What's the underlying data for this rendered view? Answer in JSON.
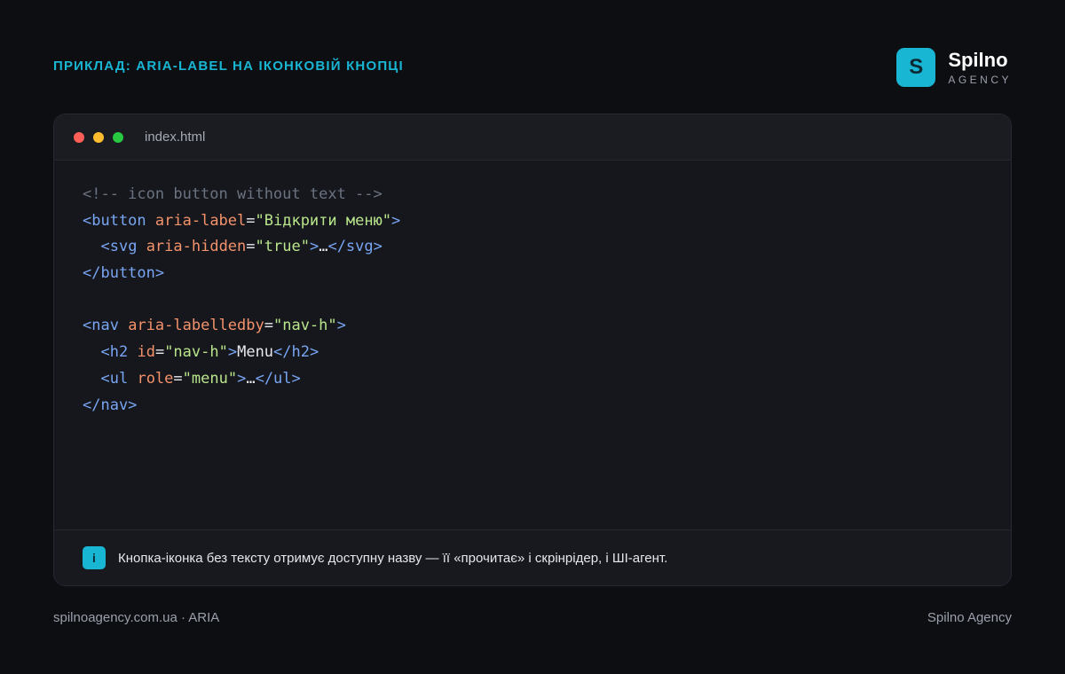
{
  "heading": "Приклад: aria-label на іконковій кнопці",
  "brand": {
    "mark": "S",
    "name": "Spilno",
    "subtitle": "AGENCY",
    "accent_color": "#19b6d4"
  },
  "window": {
    "filename": "index.html",
    "controls": [
      "close-dot",
      "minimize-dot",
      "maximize-dot"
    ]
  },
  "code": {
    "lines": [
      [
        {
          "t": "cm",
          "v": "<!-- icon button without text -->"
        }
      ],
      [
        {
          "t": "tg",
          "v": "<button"
        },
        {
          "t": "pl",
          "v": " "
        },
        {
          "t": "at",
          "v": "aria-label"
        },
        {
          "t": "pl",
          "v": "="
        },
        {
          "t": "st",
          "v": "\"Відкрити меню\""
        },
        {
          "t": "tg",
          "v": ">"
        }
      ],
      [
        {
          "t": "pl",
          "v": "  "
        },
        {
          "t": "tg",
          "v": "<svg"
        },
        {
          "t": "pl",
          "v": " "
        },
        {
          "t": "at",
          "v": "aria-hidden"
        },
        {
          "t": "pl",
          "v": "="
        },
        {
          "t": "st",
          "v": "\"true\""
        },
        {
          "t": "tg",
          "v": ">"
        },
        {
          "t": "pl",
          "v": "…"
        },
        {
          "t": "tg",
          "v": "</svg>"
        }
      ],
      [
        {
          "t": "tg",
          "v": "</button>"
        }
      ],
      [],
      [
        {
          "t": "tg",
          "v": "<nav"
        },
        {
          "t": "pl",
          "v": " "
        },
        {
          "t": "at",
          "v": "aria-labelledby"
        },
        {
          "t": "pl",
          "v": "="
        },
        {
          "t": "st",
          "v": "\"nav-h\""
        },
        {
          "t": "tg",
          "v": ">"
        }
      ],
      [
        {
          "t": "pl",
          "v": "  "
        },
        {
          "t": "tg",
          "v": "<h2"
        },
        {
          "t": "pl",
          "v": " "
        },
        {
          "t": "at",
          "v": "id"
        },
        {
          "t": "pl",
          "v": "="
        },
        {
          "t": "st",
          "v": "\"nav-h\""
        },
        {
          "t": "tg",
          "v": ">"
        },
        {
          "t": "pl",
          "v": "Menu"
        },
        {
          "t": "tg",
          "v": "</h2>"
        }
      ],
      [
        {
          "t": "pl",
          "v": "  "
        },
        {
          "t": "tg",
          "v": "<ul"
        },
        {
          "t": "pl",
          "v": " "
        },
        {
          "t": "at",
          "v": "role"
        },
        {
          "t": "pl",
          "v": "="
        },
        {
          "t": "st",
          "v": "\"menu\""
        },
        {
          "t": "tg",
          "v": ">"
        },
        {
          "t": "pl",
          "v": "…"
        },
        {
          "t": "tg",
          "v": "</ul>"
        }
      ],
      [
        {
          "t": "tg",
          "v": "</nav>"
        }
      ]
    ]
  },
  "info": {
    "icon": "i",
    "text": "Кнопка-іконка без тексту отримує доступну назву — її «прочитає» і скрінрідер, і ШІ-агент."
  },
  "footer": {
    "left": "spilnoagency.com.ua · ARIA",
    "right": "Spilno Agency"
  }
}
